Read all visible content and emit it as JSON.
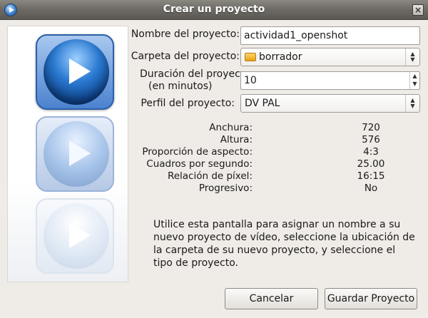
{
  "window": {
    "title": "Crear un proyecto",
    "close_glyph": "×"
  },
  "form": {
    "project_name": {
      "label": "Nombre del proyecto:",
      "value": "actividad1_openshot"
    },
    "project_folder": {
      "label": "Carpeta del proyecto:",
      "value": "borrador",
      "icon": "folder-icon"
    },
    "duration": {
      "label_line1": "Duración del proyecto",
      "label_line2": "(en minutos)",
      "value": "10"
    },
    "profile": {
      "label": "Perfil del proyecto:",
      "value": "DV PAL"
    }
  },
  "profile_info": [
    {
      "key": "Anchura:",
      "value": "720"
    },
    {
      "key": "Altura:",
      "value": "576"
    },
    {
      "key": "Proporción de aspecto:",
      "value": "4:3"
    },
    {
      "key": "Cuadros por segundo:",
      "value": "25.00"
    },
    {
      "key": "Relación de píxel:",
      "value": "16:15"
    },
    {
      "key": "Progresivo:",
      "value": "No"
    }
  ],
  "help_text": "Utilice esta pantalla para asignar un nombre a su nuevo proyecto de vídeo, seleccione la ubicación de la carpeta de su nuevo proyecto, y seleccione el tipo de proyecto.",
  "buttons": {
    "cancel": "Cancelar",
    "save": "Guardar Proyecto"
  }
}
